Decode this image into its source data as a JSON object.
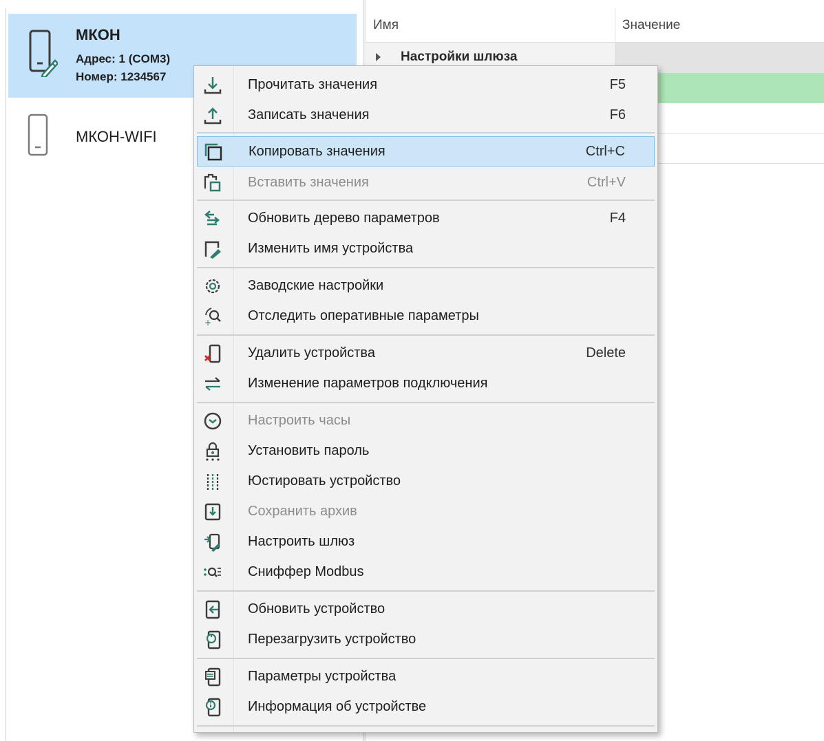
{
  "devices": [
    {
      "name": "МКОН",
      "address": "Адрес: 1 (COM3)",
      "number": "Номер: 1234567",
      "selected": true
    },
    {
      "name": "МКОН-WIFI",
      "selected": false
    }
  ],
  "grid": {
    "col_name": "Имя",
    "col_value": "Значение",
    "group_row_label": "Настройки шлюза"
  },
  "menu": {
    "items": [
      {
        "id": "read",
        "label": "Прочитать значения",
        "shortcut": "F5",
        "icon": "download-arrow-icon"
      },
      {
        "id": "write",
        "label": "Записать значения",
        "shortcut": "F6",
        "icon": "upload-arrow-icon"
      },
      {
        "id": "copy",
        "label": "Копировать значения",
        "shortcut": "Ctrl+C",
        "icon": "copy-icon",
        "highlighted": true
      },
      {
        "id": "paste",
        "label": "Вставить значения",
        "shortcut": "Ctrl+V",
        "icon": "paste-icon",
        "disabled": true
      },
      {
        "id": "refresh-tree",
        "label": "Обновить дерево параметров",
        "shortcut": "F4",
        "icon": "refresh-tree-icon"
      },
      {
        "id": "rename",
        "label": "Изменить имя устройства",
        "shortcut": "",
        "icon": "rename-device-icon"
      },
      {
        "id": "factory",
        "label": "Заводские настройки",
        "shortcut": "",
        "icon": "factory-settings-icon"
      },
      {
        "id": "monitor",
        "label": "Отследить оперативные параметры",
        "shortcut": "",
        "icon": "monitor-parameters-icon"
      },
      {
        "id": "delete",
        "label": "Удалить устройства",
        "shortcut": "Delete",
        "icon": "delete-device-icon"
      },
      {
        "id": "conn",
        "label": "Изменение параметров подключения",
        "shortcut": "",
        "icon": "connection-exchange-icon"
      },
      {
        "id": "clock",
        "label": "Настроить часы",
        "shortcut": "",
        "icon": "clock-icon",
        "disabled": true
      },
      {
        "id": "password",
        "label": "Установить пароль",
        "shortcut": "",
        "icon": "lock-icon"
      },
      {
        "id": "calibrate",
        "label": "Юстировать устройство",
        "shortcut": "",
        "icon": "calibrate-icon"
      },
      {
        "id": "archive",
        "label": "Сохранить архив",
        "shortcut": "",
        "icon": "save-archive-icon",
        "disabled": true
      },
      {
        "id": "gateway",
        "label": "Настроить шлюз",
        "shortcut": "",
        "icon": "gateway-settings-icon"
      },
      {
        "id": "sniffer",
        "label": "Сниффер Modbus",
        "shortcut": "",
        "icon": "sniffer-icon"
      },
      {
        "id": "update",
        "label": "Обновить устройство",
        "shortcut": "",
        "icon": "update-device-icon"
      },
      {
        "id": "reboot",
        "label": "Перезагрузить устройство",
        "shortcut": "",
        "icon": "reboot-device-icon"
      },
      {
        "id": "params",
        "label": "Параметры устройства",
        "shortcut": "",
        "icon": "device-parameters-icon"
      },
      {
        "id": "info",
        "label": "Информация об устройстве",
        "shortcut": "",
        "icon": "device-info-icon"
      }
    ]
  },
  "colors": {
    "selection": "#c5e2fb",
    "menu_highlight": "#cde6f7",
    "icon_dark": "#3c3c3c",
    "icon_teal": "#2f7d6e",
    "value_green": "#aee5b6"
  }
}
